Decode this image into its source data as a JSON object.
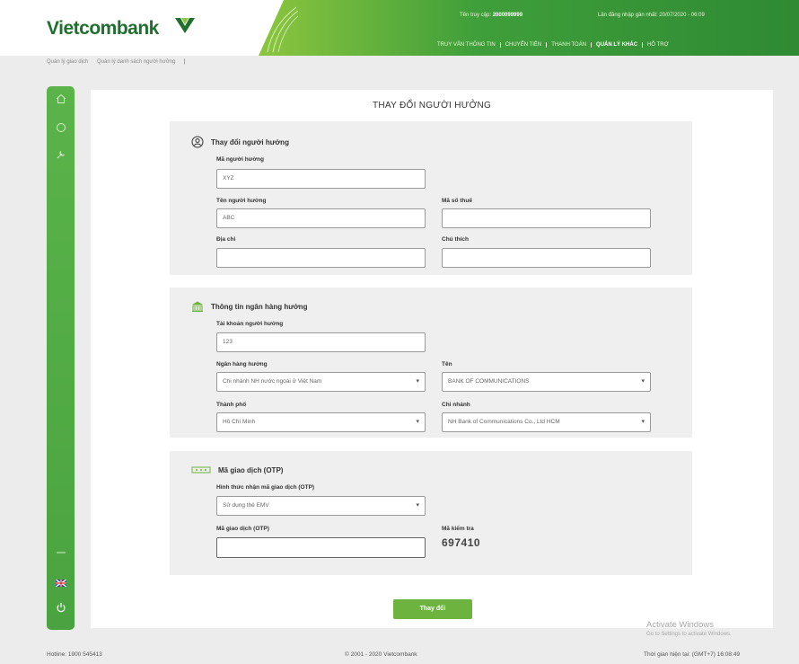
{
  "header": {
    "logo_text": "Vietcombank",
    "login_label": "Tên truy cập:",
    "username": "2000099999",
    "last_login_label": "Lần đăng nhập gần nhất:",
    "last_login_time": "20/07/2020 - 06:09",
    "nav": [
      "TRUY VẤN THÔNG TIN",
      "CHUYỂN TIỀN",
      "THANH TOÁN",
      "QUẢN LÝ KHÁC",
      "HỖ TRỢ"
    ],
    "active_nav": "QUẢN LÝ KHÁC"
  },
  "breadcrumb": [
    "Quản lý giao dịch",
    "Quản lý danh sách người hưởng"
  ],
  "page": {
    "title": "THAY ĐỔI NGƯỜI HƯỞNG"
  },
  "section_beneficiary": {
    "heading": "Thay đổi người hưởng",
    "code_label": "Mã người hưởng",
    "code_value": "XYZ",
    "name_label": "Tên người hưởng",
    "name_value": "ABC",
    "tax_label": "Mã số thuế",
    "tax_value": "",
    "address_label": "Địa chỉ",
    "address_value": "",
    "note_label": "Chú thích",
    "note_value": ""
  },
  "section_bank": {
    "heading": "Thông tin ngân hàng hưởng",
    "account_label": "Tài khoản người hưởng",
    "account_value": "123",
    "bank_label": "Ngân hàng hưởng",
    "bank_value": "Chi nhánh NH nước ngoài ở Việt Nam",
    "name_label": "Tên",
    "name_value": "BANK OF COMMUNICATIONS",
    "city_label": "Thành phố",
    "city_value": "Hồ Chí Minh",
    "branch_label": "Chi nhánh",
    "branch_value": "NH Bank of Communications Co., Ltd HCM"
  },
  "section_otp": {
    "heading": "Mã giao dịch (OTP)",
    "method_label": "Hình thức nhận mã giao dịch (OTP)",
    "method_value": "Sử dụng thẻ EMV",
    "otp_label": "Mã giao dịch (OTP)",
    "otp_value": "",
    "check_label": "Mã kiểm tra",
    "check_code": "697410"
  },
  "submit_label": "Thay đổi",
  "footer": {
    "hotline": "Hotline: 1900 545413",
    "copyright": "© 2001 - 2020 Vietcombank",
    "current_time": "Thời gian hiện tại: (GMT+7) 16:08:49"
  },
  "watermark": {
    "line1": "Activate Windows",
    "line2": "Go to Settings to activate Windows."
  },
  "sidebar": {
    "language_flag": "uk-flag-icon"
  },
  "colors": {
    "brand_green": "#1f6f2e",
    "sidebar_green": "#4fa845",
    "button_green": "#6cb33f",
    "section_bg": "#efefef"
  }
}
